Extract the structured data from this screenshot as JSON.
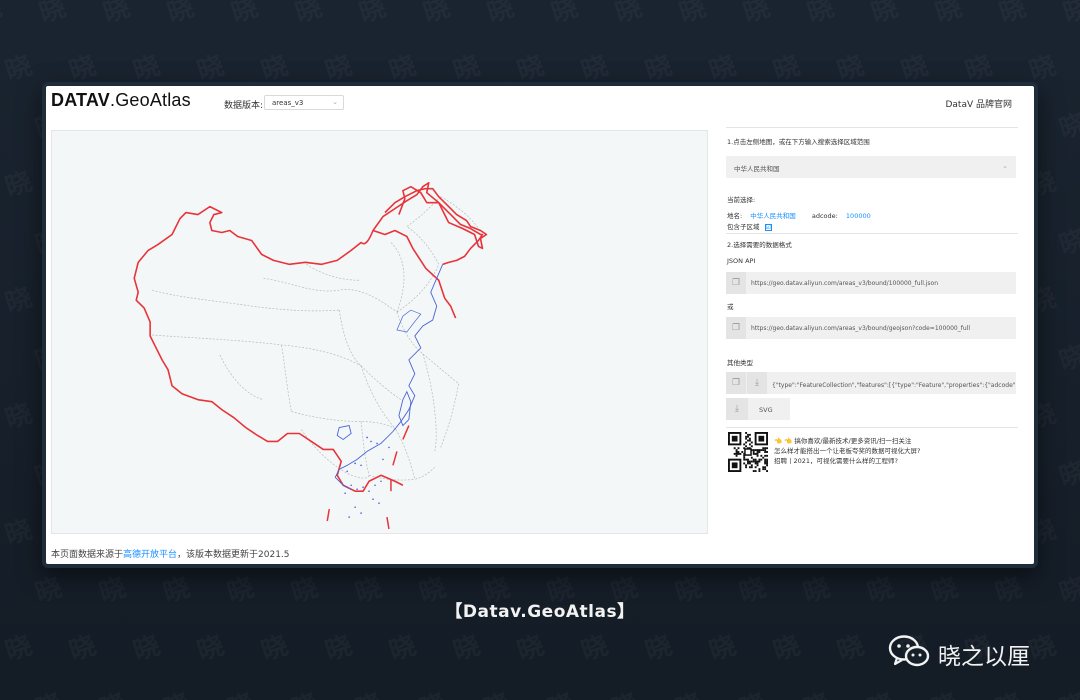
{
  "watermark": {
    "char": "晓"
  },
  "header": {
    "logo_bold": "DATAV",
    "logo_light": ".GeoAtlas",
    "version_label": "数据版本:",
    "version_value": "areas_v3",
    "brand_link": "DataV 品牌官网"
  },
  "sidebar": {
    "step1": "1.点击左侧地图，或在下方输入搜索选择区域范围",
    "region_select": "中华人民共和国",
    "current_label": "当前选择:",
    "name_label": "地名:",
    "name_value": "中华人民共和国",
    "adcode_label": "adcode:",
    "adcode_value": "100000",
    "include_sub_label": "包含子区域",
    "include_sub_checked": "☑",
    "step2": "2.选择需要的数据格式",
    "json_api_label": "JSON API",
    "url_full": "https://geo.datav.aliyun.com/areas_v3/bound/100000_full.json",
    "or_label": "或",
    "url_geojson": "https://geo.datav.aliyun.com/areas_v3/bound/geojson?code=100000_full",
    "other_types_label": "其他类型",
    "geojson_preview": "{\"type\":\"FeatureCollection\",\"features\":[{\"type\":\"Feature\",\"properties\":{\"adcode\":110000,\"name\":\"北京市\"",
    "svg_label": "SVG",
    "promo": [
      "👈 👈 搞你喜欢/最新技术/更多资讯/扫一扫关注",
      "怎么样才能搭出一个让老板夸奖的数据可视化大屏?",
      "招聘丨2021，可视化需要什么样的工程师?"
    ]
  },
  "footer": {
    "prefix": "本页面数据来源于",
    "link": "高德开放平台",
    "suffix": "，该版本数据更新于2021.5"
  },
  "caption": "【Datav.GeoAtlas】",
  "author": "晓之以厘",
  "colors": {
    "border_red": "#e8333a",
    "coast_blue": "#4a63d8",
    "link_blue": "#1890ff",
    "map_bg": "#f3f7f7"
  },
  "icons": {
    "copy": "copy-icon",
    "download": "download-icon",
    "chevron": "chevron-down-icon",
    "qr": "qr-code-icon",
    "wechat": "wechat-icon"
  }
}
